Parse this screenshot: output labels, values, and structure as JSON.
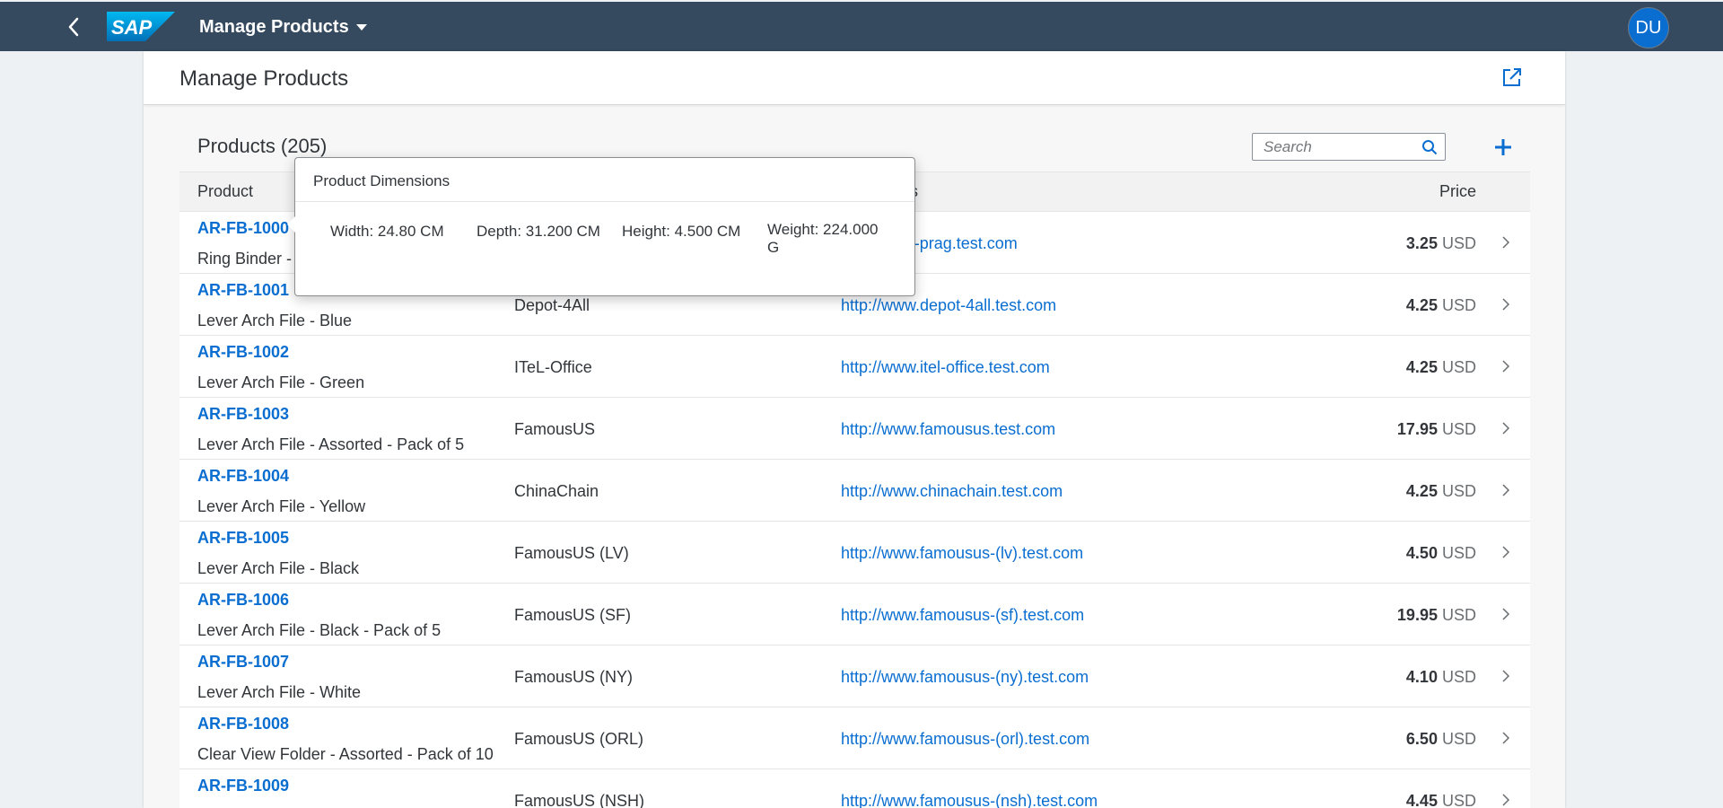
{
  "shell": {
    "title": "Manage Products",
    "avatar_initials": "DU",
    "logo_text": "SAP",
    "colors": {
      "bar": "#354a5f",
      "avatar": "#0a6ed1",
      "logo": "#0a9be0"
    }
  },
  "page": {
    "title": "Manage Products"
  },
  "toolbar": {
    "title": "Products (205)",
    "search_placeholder": "Search"
  },
  "table": {
    "columns": {
      "product": "Product",
      "address": "ess",
      "price": "Price"
    },
    "rows": [
      {
        "id": "AR-FB-1000",
        "name": "Ring Binder - (",
        "supplier": "",
        "url": ".office-line-prag.test.com",
        "price": "3.25",
        "currency": "USD"
      },
      {
        "id": "AR-FB-1001",
        "name": "Lever Arch File - Blue",
        "supplier": "Depot-4All",
        "url": "http://www.depot-4all.test.com",
        "price": "4.25",
        "currency": "USD"
      },
      {
        "id": "AR-FB-1002",
        "name": "Lever Arch File - Green",
        "supplier": "ITeL-Office",
        "url": "http://www.itel-office.test.com",
        "price": "4.25",
        "currency": "USD"
      },
      {
        "id": "AR-FB-1003",
        "name": "Lever Arch File - Assorted - Pack of 5",
        "supplier": "FamousUS",
        "url": "http://www.famousus.test.com",
        "price": "17.95",
        "currency": "USD"
      },
      {
        "id": "AR-FB-1004",
        "name": "Lever Arch File - Yellow",
        "supplier": "ChinaChain",
        "url": "http://www.chinachain.test.com",
        "price": "4.25",
        "currency": "USD"
      },
      {
        "id": "AR-FB-1005",
        "name": "Lever Arch File - Black",
        "supplier": "FamousUS (LV)",
        "url": "http://www.famousus-(lv).test.com",
        "price": "4.50",
        "currency": "USD"
      },
      {
        "id": "AR-FB-1006",
        "name": "Lever Arch File - Black - Pack of 5",
        "supplier": "FamousUS (SF)",
        "url": "http://www.famousus-(sf).test.com",
        "price": "19.95",
        "currency": "USD"
      },
      {
        "id": "AR-FB-1007",
        "name": "Lever Arch File - White",
        "supplier": "FamousUS (NY)",
        "url": "http://www.famousus-(ny).test.com",
        "price": "4.10",
        "currency": "USD"
      },
      {
        "id": "AR-FB-1008",
        "name": "Clear View Folder - Assorted - Pack of 10",
        "supplier": "FamousUS (ORL)",
        "url": "http://www.famousus-(orl).test.com",
        "price": "6.50",
        "currency": "USD"
      },
      {
        "id": "AR-FB-1009",
        "name": "",
        "supplier": "FamousUS (NSH)",
        "url": "http://www.famousus-(nsh).test.com",
        "price": "4.45",
        "currency": "USD"
      }
    ]
  },
  "popover": {
    "title": "Product Dimensions",
    "width": "Width: 24.80 CM",
    "depth": "Depth: 31.200 CM",
    "height": "Height: 4.500 CM",
    "weight": "Weight: 224.000 G"
  }
}
